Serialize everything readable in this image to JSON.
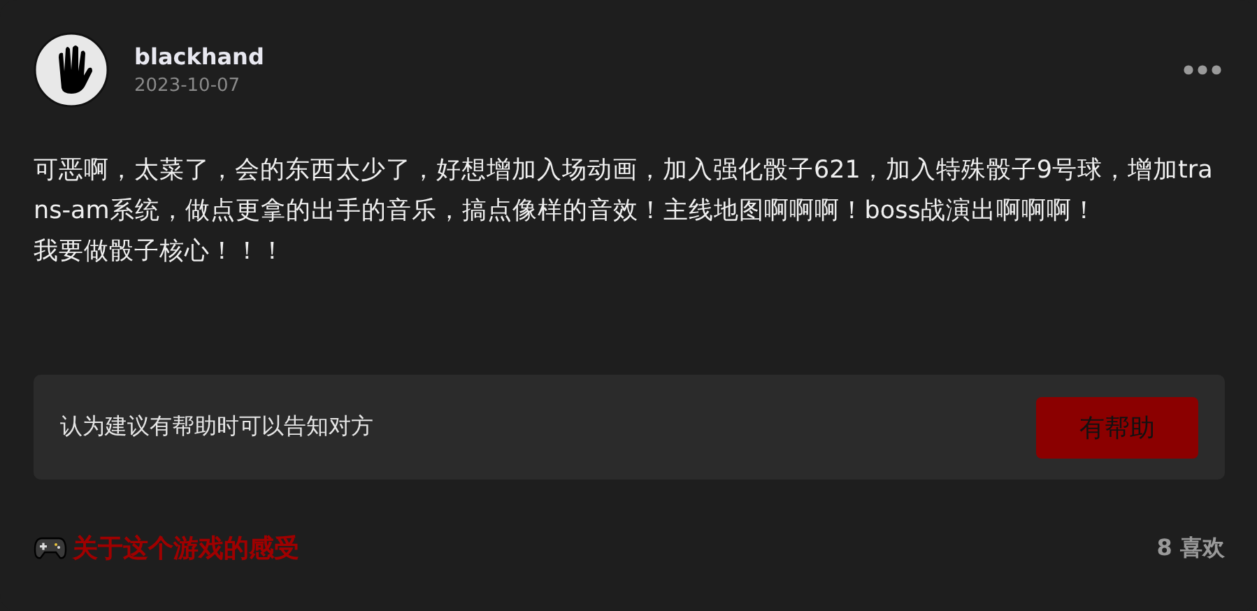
{
  "author": {
    "name": "blackhand",
    "date": "2023-10-07"
  },
  "body": [
    "可恶啊，太菜了，会的东西太少了，好想增加入场动画，加入强化骰子621，加入特殊骰子9号球，增加trans-am系统，做点更拿的出手的音乐，搞点像样的音效！主线地图啊啊啊！boss战演出啊啊啊！",
    "我要做骰子核心！！！"
  ],
  "helpful_prompt": {
    "text": "认为建议有帮助时可以告知对方",
    "button": "有帮助"
  },
  "footer": {
    "topic": "关于这个游戏的感受",
    "likes": "8 喜欢"
  }
}
